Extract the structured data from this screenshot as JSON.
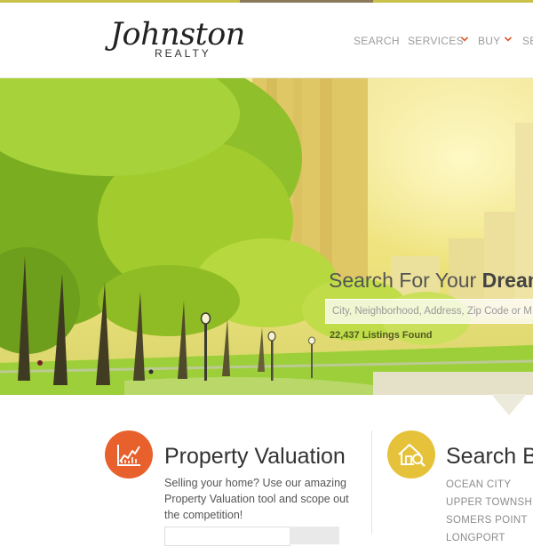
{
  "brand": {
    "name": "Johnston",
    "tagline": "REALTY"
  },
  "nav": {
    "items": [
      {
        "label": "SEARCH"
      },
      {
        "label": "SERVICES"
      },
      {
        "label": "BUY"
      },
      {
        "label": "SE"
      }
    ]
  },
  "hero": {
    "title_light": "Search For Your ",
    "title_bold": "Dream",
    "search_placeholder": "City, Neighborhood, Address, Zip Code or M",
    "listings_found": "22,437 Listings Found"
  },
  "valuation": {
    "title": "Property Valuation",
    "description": "Selling your home? Use our amazing Property Valuation tool and scope out the competition!"
  },
  "search_by": {
    "title": "Search By",
    "cities": [
      "OCEAN CITY",
      "UPPER TOWNSHIP",
      "SOMERS POINT",
      "LONGPORT"
    ]
  },
  "colors": {
    "accent_orange": "#e8602c",
    "accent_yellow": "#e6c23b",
    "nav_chevron": "#e05a2a"
  },
  "icons": {
    "valuation": "chart-growth-icon",
    "search_by": "house-search-icon",
    "chevron": "chevron-down-icon"
  }
}
